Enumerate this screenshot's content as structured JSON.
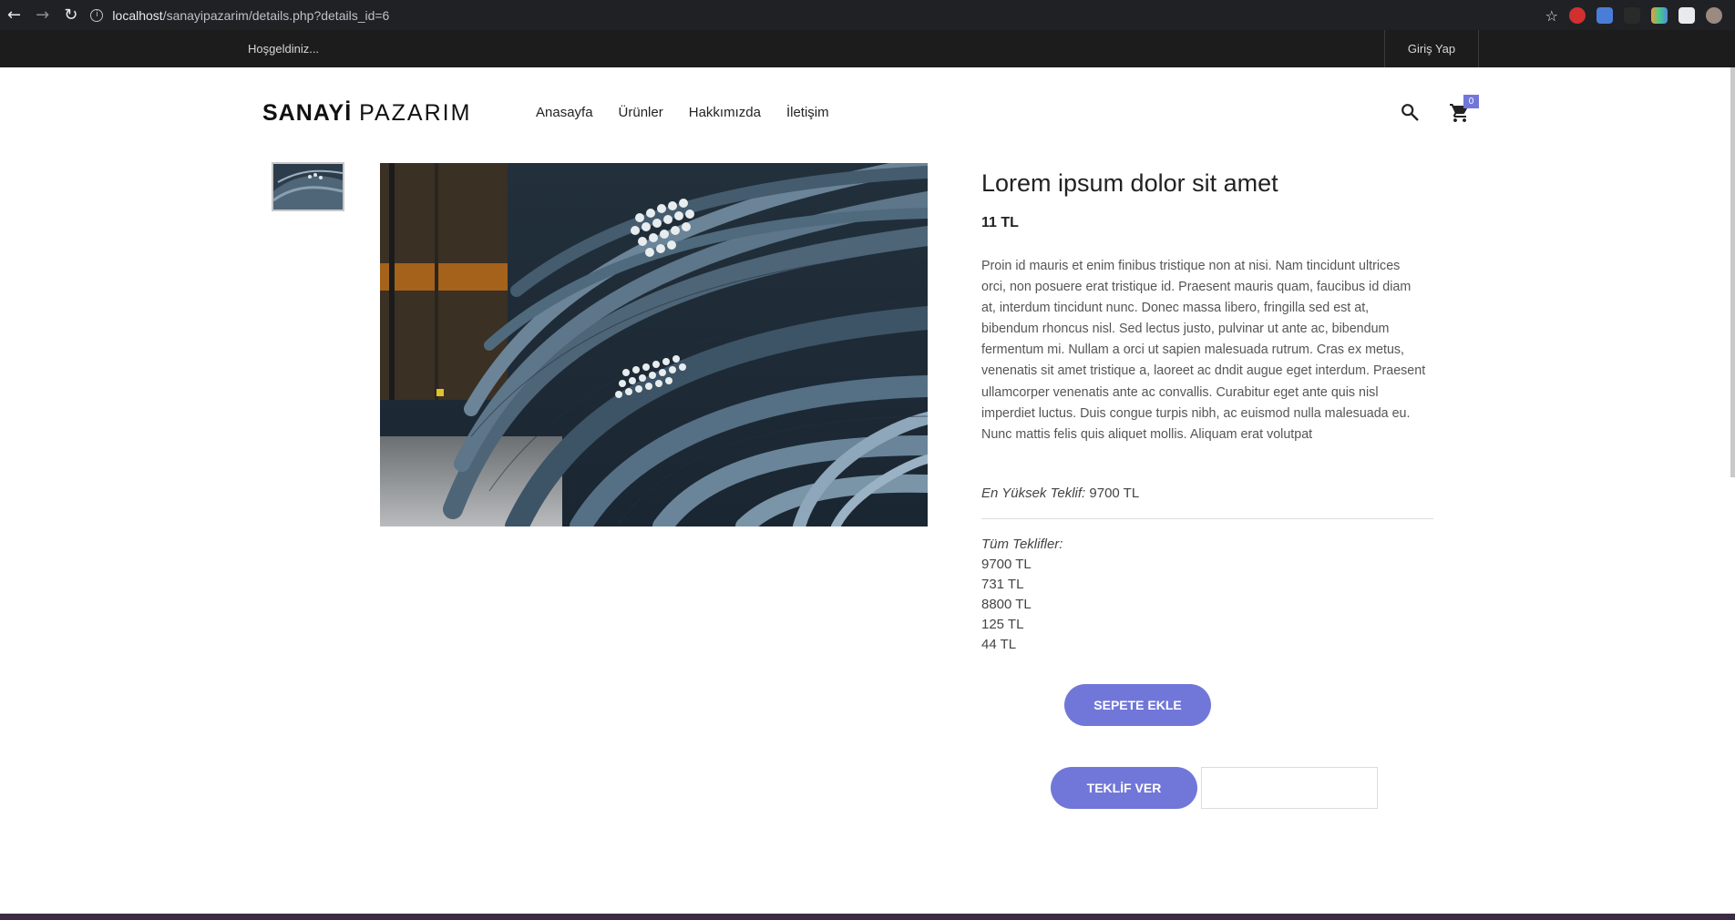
{
  "browser": {
    "url_host": "localhost",
    "url_path": "/sanayipazarim/details.php?details_id=6",
    "back_icon": "arrow-left-icon",
    "forward_icon": "arrow-right-icon",
    "reload_icon": "reload-icon",
    "info_icon": "info-icon"
  },
  "topbar": {
    "welcome": "Hoşgeldiniz...",
    "login": "Giriş Yap"
  },
  "header": {
    "logo_bold": "SANAYİ",
    "logo_light": "PAZARIM",
    "nav": [
      "Anasayfa",
      "Ürünler",
      "Hakkımızda",
      "İletişim"
    ],
    "cart_count": "0"
  },
  "product": {
    "title": "Lorem ipsum dolor sit amet",
    "price": "11 TL",
    "description": "Proin id mauris et enim finibus tristique non at nisi. Nam tincidunt ultrices orci, non posuere erat tristique id. Praesent mauris quam, faucibus id diam at, interdum tincidunt nunc. Donec massa libero, fringilla sed est at, bibendum rhoncus nisl. Sed lectus justo, pulvinar ut ante ac, bibendum fermentum mi. Nullam a orci ut sapien malesuada rutrum. Cras ex metus, venenatis sit amet tristique a, laoreet ac dndit augue eget interdum. Praesent ullamcorper venenatis ante ac convallis. Curabitur eget ante quis nisl imperdiet luctus. Duis congue turpis nibh, ac euismod nulla malesuada eu. Nunc mattis felis quis aliquet mollis. Aliquam erat volutpat",
    "highest_label": "En Yüksek Teklif:",
    "highest_value": "9700 TL",
    "all_offers_label": "Tüm Teklifler:",
    "offers": [
      "9700 TL",
      "731 TL",
      "8800 TL",
      "125 TL",
      "44 TL"
    ],
    "add_to_cart": "SEPETE EKLE",
    "make_offer": "TEKLİF VER",
    "offer_input_value": ""
  },
  "colors": {
    "accent": "#7177d8",
    "topbar": "#1c1c1c"
  }
}
